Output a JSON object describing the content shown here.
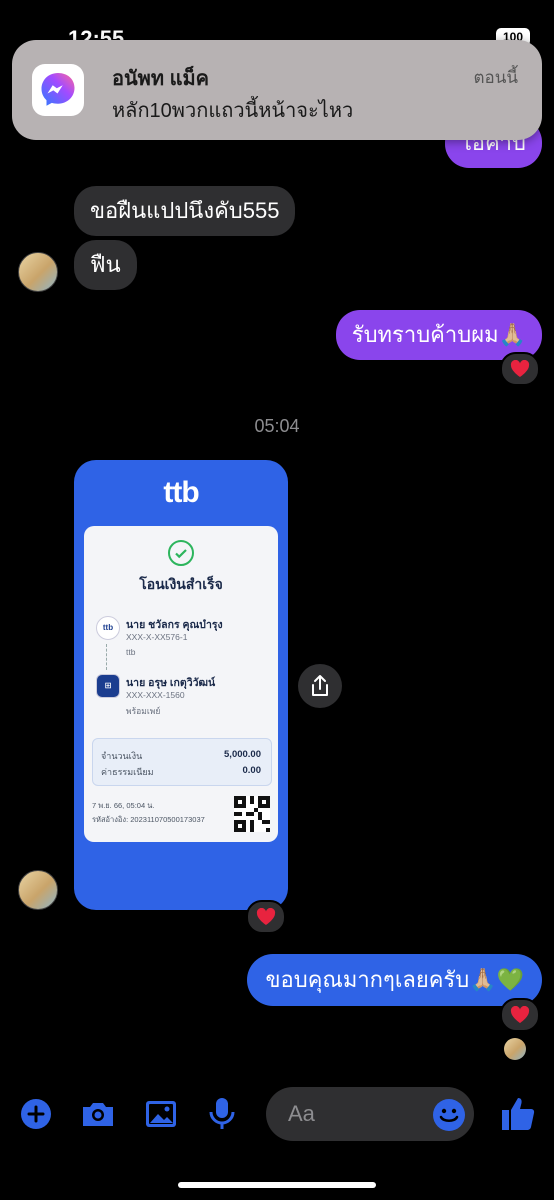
{
  "status": {
    "time": "12:55",
    "battery": "100"
  },
  "notification": {
    "app_icon": "messenger-icon",
    "sender": "อนัพท แม็ค",
    "message": "หลัก10พวกแถวนี้หน้าจะไหว",
    "time": "ตอนนี้"
  },
  "messages": {
    "partial_top": "ไอค้าบ",
    "incoming_1": "ขอฝืนแปปนึงคับ555",
    "incoming_2": "ฟืน",
    "outgoing_1": "รับทราบค้าบผม🙏🏼",
    "timestamp": "05:04",
    "outgoing_2": "ขอบคุณมากๆเลยครับ🙏🏼💚"
  },
  "receipt": {
    "bank_logo": "ttb",
    "title": "โอนเงินสำเร็จ",
    "from_name": "นาย ชวัลกร คุณบำรุง",
    "from_account": "XXX-X-XX576-1",
    "from_bank": "ttb",
    "to_name": "นาย อรุษ เกตุวิวัฒน์",
    "to_account": "XXX-XXX-1560",
    "to_bank": "พร้อมเพย์",
    "amount_label": "จำนวนเงิน",
    "amount_value": "5,000.00",
    "fee_label": "ค่าธรรมเนียม",
    "fee_value": "0.00",
    "date": "7 พ.ย. 66, 05:04 น.",
    "reference": "รหัสอ้างอิง: 2023110705001730​37"
  },
  "composer": {
    "placeholder": "Aa"
  },
  "colors": {
    "outgoing_purple": "#8a45ec",
    "outgoing_blue": "#2f63e6",
    "incoming": "#2f2f31",
    "card": "#2f63e6"
  }
}
